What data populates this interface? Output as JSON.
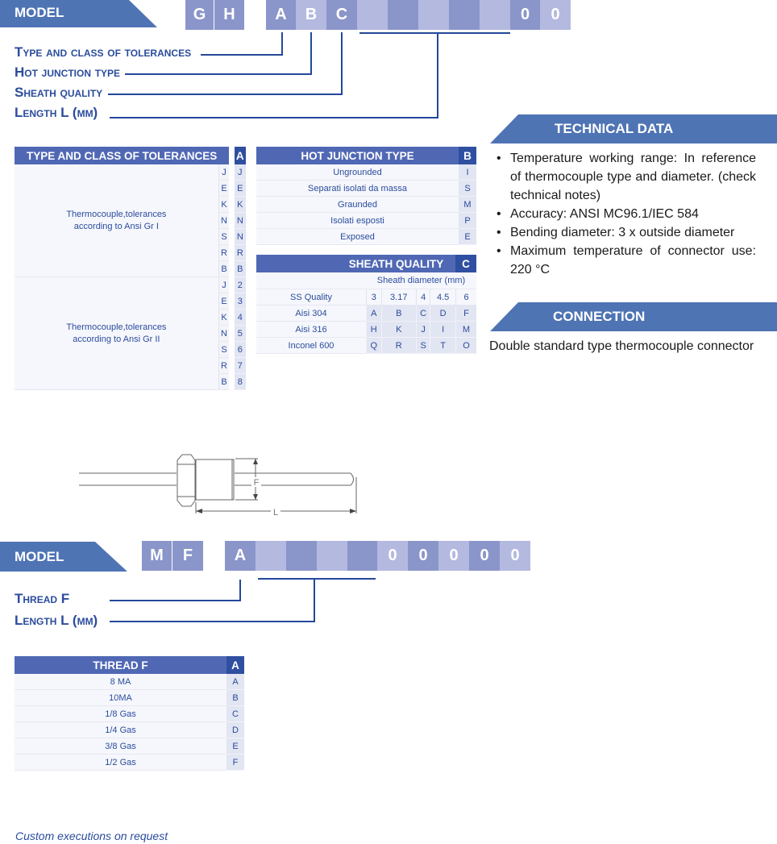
{
  "model1": {
    "banner_label": "MODEL",
    "codes": [
      "G",
      "H",
      "A",
      "B",
      "C",
      "",
      "",
      "",
      "",
      "",
      "0",
      "0"
    ],
    "leaders": [
      {
        "label": "Type and class of tolerances"
      },
      {
        "label": "Hot junction type"
      },
      {
        "label": "Sheath quality"
      },
      {
        "label": "Length L (mm)"
      }
    ]
  },
  "tolerances_table": {
    "header": "TYPE AND CLASS OF TOLERANCES",
    "code_header": "A",
    "groups": [
      {
        "description": "Thermocouple,tolerances according to Ansi Gr I",
        "rows": [
          [
            "J",
            "J"
          ],
          [
            "E",
            "E"
          ],
          [
            "K",
            "K"
          ],
          [
            "N",
            "N"
          ],
          [
            "S",
            "N"
          ],
          [
            "R",
            "R"
          ],
          [
            "B",
            "B"
          ]
        ]
      },
      {
        "description": "Thermocouple,tolerances according to Ansi Gr II",
        "rows": [
          [
            "J",
            "2"
          ],
          [
            "E",
            "3"
          ],
          [
            "K",
            "4"
          ],
          [
            "N",
            "5"
          ],
          [
            "S",
            "6"
          ],
          [
            "R",
            "7"
          ],
          [
            "B",
            "8"
          ]
        ]
      }
    ]
  },
  "hot_junction_table": {
    "header": "HOT JUNCTION TYPE",
    "code_header": "B",
    "rows": [
      [
        "Ungrounded",
        "I"
      ],
      [
        "Separati isolati da massa",
        "S"
      ],
      [
        "Graunded",
        "M"
      ],
      [
        "Isolati esposti",
        "P"
      ],
      [
        "Exposed",
        "E"
      ]
    ]
  },
  "sheath_table": {
    "header": "SHEATH QUALITY",
    "code_header": "C",
    "subheader": "Sheath diameter (mm)",
    "row_header": "SS Quality",
    "diameters": [
      "3",
      "3.17",
      "4",
      "4.5",
      "6"
    ],
    "rows": [
      {
        "quality": "Aisi 304",
        "codes": [
          "A",
          "B",
          "C",
          "D",
          "F"
        ]
      },
      {
        "quality": "Aisi 316",
        "codes": [
          "H",
          "K",
          "J",
          "I",
          "M"
        ]
      },
      {
        "quality": "Inconel 600",
        "codes": [
          "Q",
          "R",
          "S",
          "T",
          "O"
        ]
      }
    ]
  },
  "technical_data": {
    "title": "TECHNICAL DATA",
    "items": [
      "Temperature working range: In reference of thermocouple type and diameter. (check technical notes)",
      "Accuracy: ANSI MC96.1/IEC 584",
      "Bending diameter: 3 x outside diameter",
      "Maximum temperature of connector use: 220 °C"
    ]
  },
  "connection": {
    "title": "CONNECTION",
    "text": "Double standard type thermocouple connector"
  },
  "drawing": {
    "thread_label": "F",
    "length_label": "L"
  },
  "model2": {
    "banner_label": "MODEL",
    "codes": [
      "M",
      "F",
      "A",
      "",
      "",
      "",
      "",
      "0",
      "0",
      "0",
      "0",
      "0"
    ],
    "leaders": [
      {
        "label": "Thread F"
      },
      {
        "label": "Length L (mm)"
      }
    ]
  },
  "thread_table": {
    "header": "THREAD F",
    "code_header": "A",
    "rows": [
      [
        "8 MA",
        "A"
      ],
      [
        "10MA",
        "B"
      ],
      [
        "1/8 Gas",
        "C"
      ],
      [
        "1/4 Gas",
        "D"
      ],
      [
        "3/8 Gas",
        "E"
      ],
      [
        "1/2 Gas",
        "F"
      ]
    ]
  },
  "footer": {
    "note": "Custom executions on request"
  }
}
